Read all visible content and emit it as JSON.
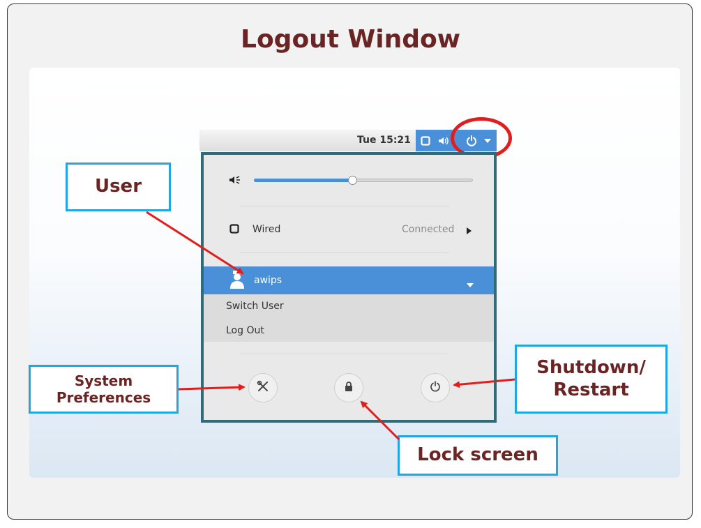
{
  "slide": {
    "title": "Logout Window"
  },
  "topbar": {
    "clock": "Tue 15:21"
  },
  "menu": {
    "volume": {
      "level": 0.45
    },
    "network": {
      "label": "Wired",
      "status": "Connected"
    },
    "user": {
      "name": "awips",
      "items": [
        "Switch User",
        "Log Out"
      ]
    },
    "bottom_buttons": [
      "settings-icon",
      "lock-icon",
      "power-icon"
    ]
  },
  "callouts": {
    "user": "User",
    "system_preferences_line1": "System",
    "system_preferences_line2": "Preferences",
    "shutdown_line1": "Shutdown/",
    "shutdown_line2": "Restart",
    "lock_screen": "Lock screen"
  },
  "colors": {
    "title": "#6b2424",
    "accent_blue": "#4a90d9",
    "callout_border": "#1ea7e1",
    "arrow_red": "#e01e1e"
  }
}
